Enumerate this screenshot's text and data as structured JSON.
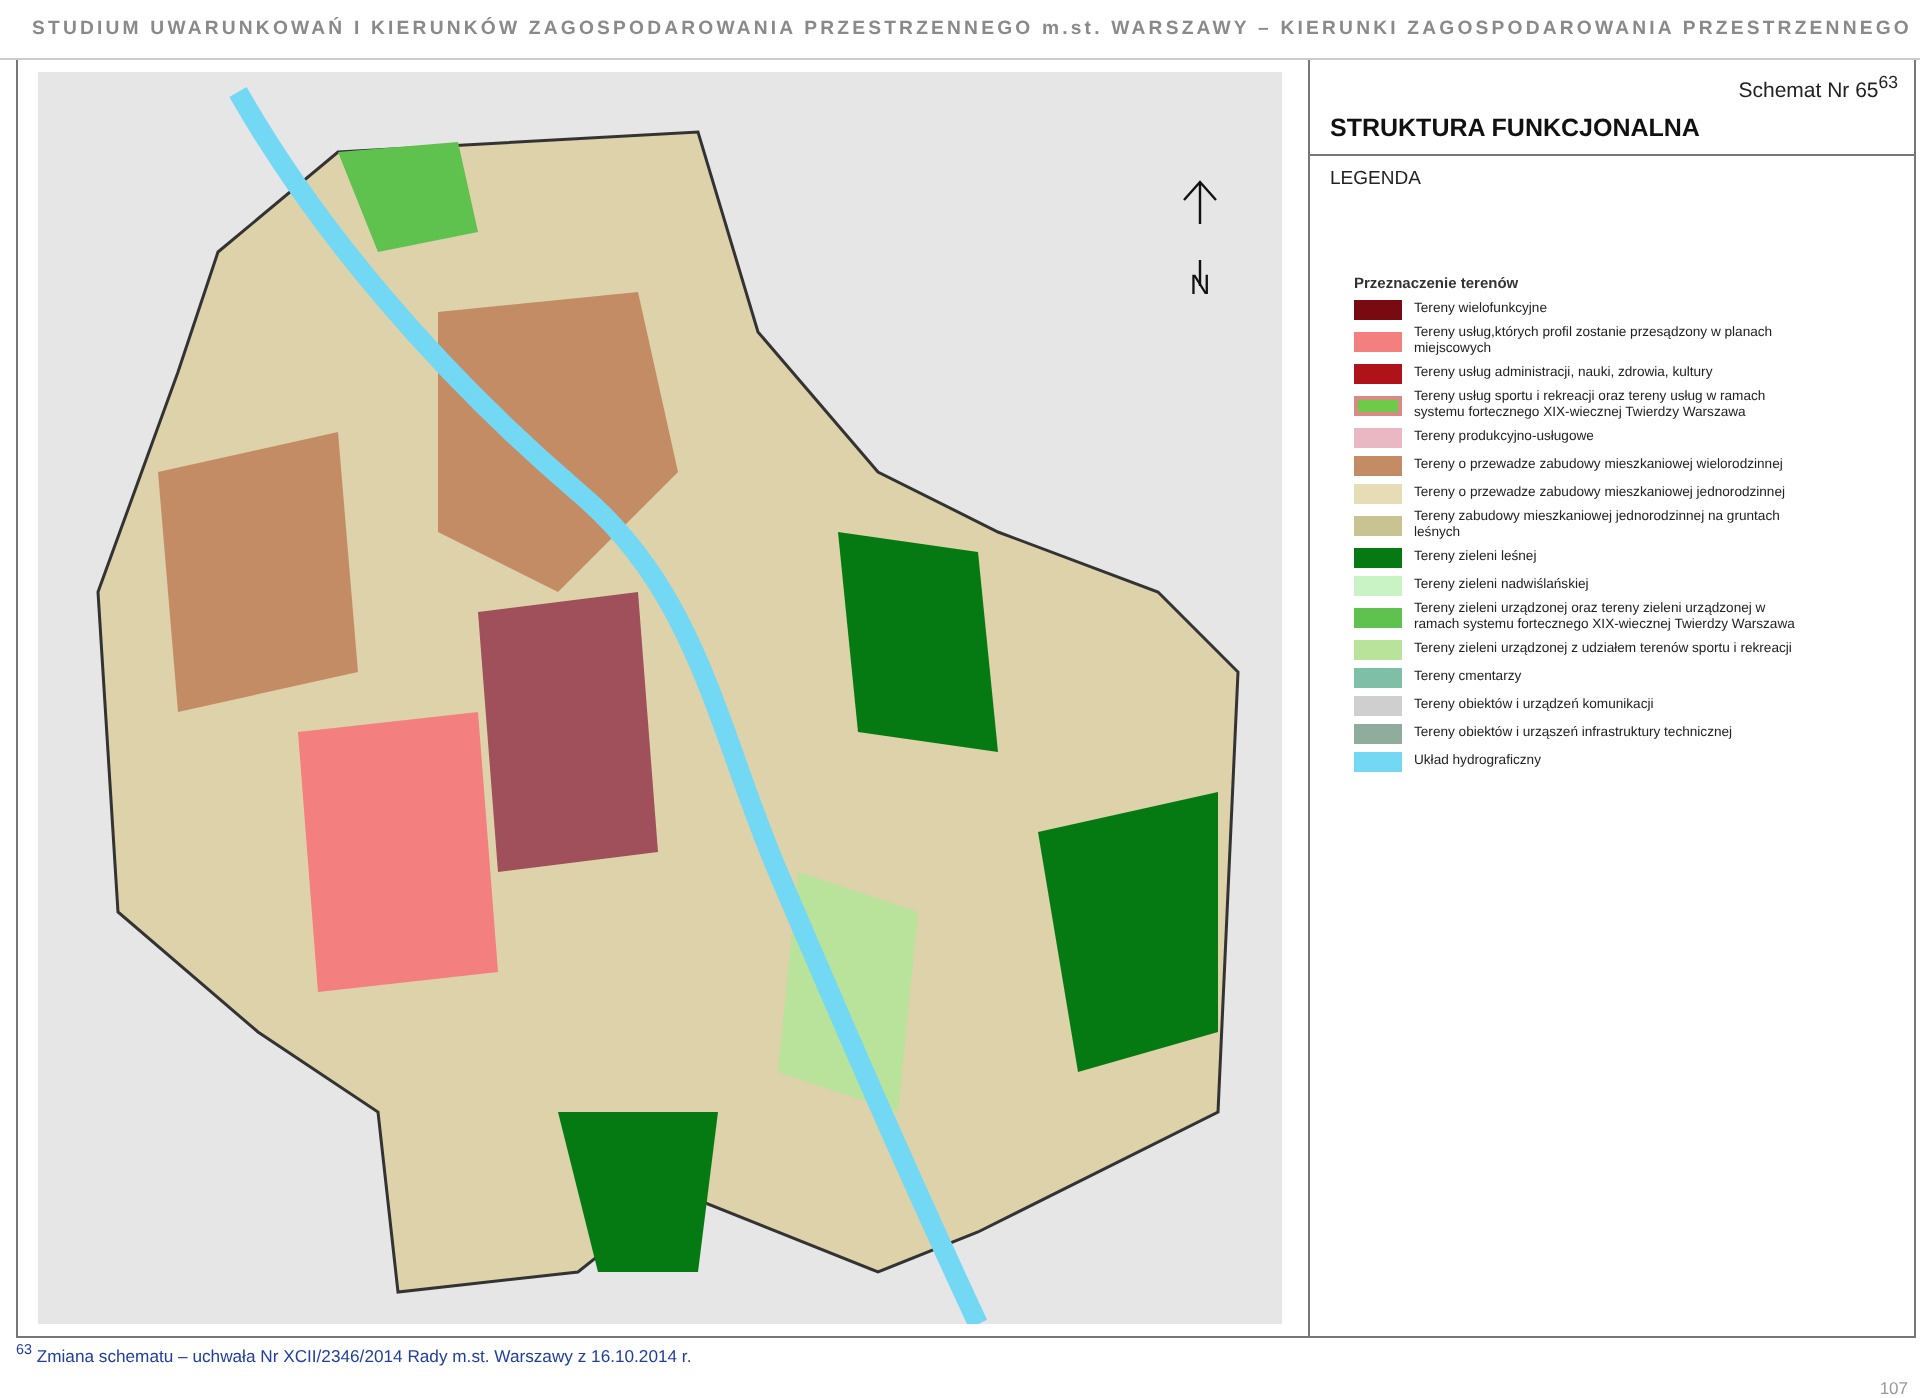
{
  "header": {
    "title": "STUDIUM UWARUNKOWAŃ I KIERUNKÓW ZAGOSPODAROWANIA PRZESTRZENNEGO m.st. WARSZAWY  –  KIERUNKI ZAGOSPODAROWANIA PRZESTRZENNEGO"
  },
  "map": {
    "north_label": "N"
  },
  "legend": {
    "schema_number": "Schemat Nr 65$^{63}$",
    "title": "STRUKTURA FUNKCJONALNA",
    "heading": "LEGENDA",
    "section_title": "Przeznaczenie terenów",
    "items": [
      {
        "kind": "fill",
        "color": "#7a0a12",
        "label": "Tereny wielofunkcyjne"
      },
      {
        "kind": "fill",
        "color": "#f47f7f",
        "label": "Tereny usług,których profil zostanie przesądzony w planach miejscowych"
      },
      {
        "kind": "fill",
        "color": "#b0121a",
        "label": "Tereny usług administracji, nauki, zdrowia, kultury"
      },
      {
        "kind": "outlined",
        "color": "#6ccc4a",
        "label": "Tereny usług sportu i rekreacji oraz tereny usług w ramach systemu fortecznego XIX-wiecznej Twierdzy Warszawa"
      },
      {
        "kind": "fill",
        "color": "#e9b8c2",
        "label": "Tereny produkcyjno-usługowe"
      },
      {
        "kind": "fill",
        "color": "#c48c64",
        "label": "Tereny o przewadze zabudowy mieszkaniowej wielorodzinnej"
      },
      {
        "kind": "fill",
        "color": "#e6dcb6",
        "label": "Tereny o przewadze zabudowy mieszkaniowej jednorodzinnej"
      },
      {
        "kind": "fill",
        "color": "#c9c392",
        "label": "Tereny zabudowy mieszkaniowej jednorodzinnej na gruntach leśnych"
      },
      {
        "kind": "fill",
        "color": "#067a12",
        "label": "Tereny zieleni leśnej"
      },
      {
        "kind": "fill",
        "color": "#c9f3c4",
        "label": "Tereny zieleni nadwiślańskiej"
      },
      {
        "kind": "fill",
        "color": "#5fc24e",
        "label": "Tereny zieleni urządzonej oraz tereny zieleni urządzonej w ramach systemu fortecznego XIX-wiecznej Twierdzy Warszawa"
      },
      {
        "kind": "fill",
        "color": "#b9e39a",
        "label": "Tereny zieleni urządzonej z udziałem terenów sportu i rekreacji"
      },
      {
        "kind": "fill",
        "color": "#7fbfa8",
        "label": "Tereny cmentarzy"
      },
      {
        "kind": "fill",
        "color": "#cfcfcf",
        "label": "Tereny obiektów i urządzeń komunikacji"
      },
      {
        "kind": "fill",
        "color": "#8fac9c",
        "label": "Tereny obiektów i urząszeń infrastruktury technicznej"
      },
      {
        "kind": "fill",
        "color": "#72d8f4",
        "label": "Układ hydrograficzny"
      }
    ]
  },
  "footnote": "$^{63}$ Zmiana schematu – uchwała Nr XCII/2346/2014 Rady m.st. Warszawy z 16.10.2014 r.",
  "page_number": "107"
}
